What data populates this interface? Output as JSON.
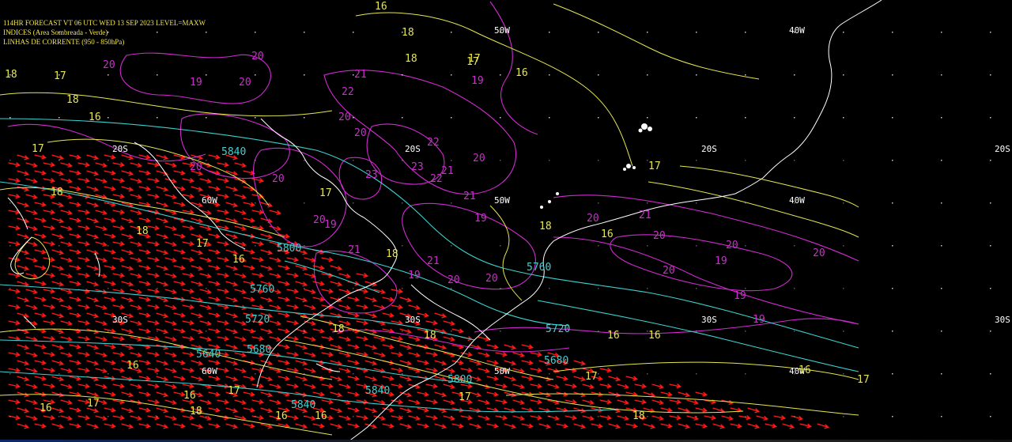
{
  "header": {
    "line1": "114HR FORECAST   VT 06 UTC WED 13 SEP 2023   LEVEL=MAXW",
    "line2": "INDICES (Area Sombreada - Verde)",
    "line3": "LINHAS DE CORRENTE (950 - 850hPa)"
  },
  "colors": {
    "background": "#000000",
    "header_text": "#f2e64a",
    "magenta_isolines": "#d22ad2",
    "yellow_isolines": "#e6e650",
    "cyan_isolines": "#3cd2d2",
    "wind_arrows": "#ff1a1a",
    "coastline": "#ffffff",
    "grid_labels": "#ffffff"
  },
  "grid_labels": [
    "60W",
    "50W",
    "40W",
    "20S",
    "30S"
  ],
  "cyan_labels": [
    "5840",
    "5800",
    "5760",
    "5720",
    "5640",
    "5680",
    "5840",
    "5800",
    "5760",
    "5720",
    "5680",
    "5840"
  ],
  "magenta_labels": [
    "20",
    "19",
    "20",
    "20",
    "21",
    "22",
    "20",
    "20",
    "22",
    "23",
    "22",
    "21",
    "23",
    "20",
    "20",
    "20",
    "19",
    "21",
    "19",
    "21",
    "20",
    "20",
    "21",
    "19",
    "19",
    "20",
    "20",
    "21",
    "20",
    "19",
    "20",
    "20",
    "19",
    "20",
    "19"
  ],
  "yellow_labels": [
    "16",
    "18",
    "18",
    "17",
    "18",
    "17",
    "16",
    "18",
    "17",
    "18",
    "18",
    "17",
    "16",
    "17",
    "18",
    "18",
    "18",
    "16",
    "17",
    "16",
    "18",
    "17",
    "16",
    "16",
    "17",
    "16",
    "16",
    "18",
    "17",
    "16",
    "16",
    "17",
    "16",
    "17",
    "18",
    "17",
    "16"
  ]
}
